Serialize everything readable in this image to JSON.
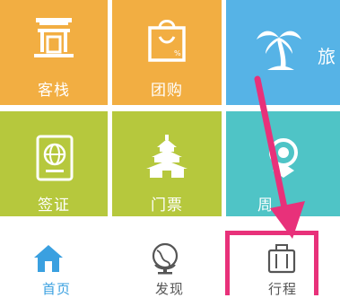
{
  "tiles": [
    {
      "key": "inn",
      "label": "客栈",
      "color": "#f2ae42",
      "icon": "inn-icon"
    },
    {
      "key": "group",
      "label": "团购",
      "color": "#f2ae42",
      "icon": "shopping-bag-icon"
    },
    {
      "key": "travel",
      "label": "旅",
      "color": "#56b3e6",
      "icon": "palm-tree-icon"
    },
    {
      "key": "visa",
      "label": "签证",
      "color": "#b6c83d",
      "icon": "passport-icon"
    },
    {
      "key": "ticket",
      "label": "门票",
      "color": "#b6c83d",
      "icon": "temple-icon"
    },
    {
      "key": "around",
      "label": "周",
      "color": "#4fc4c6",
      "icon": "location-pin-icon"
    }
  ],
  "tabbar": {
    "home": {
      "label": "首页",
      "icon": "home-icon",
      "active": true
    },
    "discover": {
      "label": "发现",
      "icon": "globe-icon",
      "active": false
    },
    "trip": {
      "label": "行程",
      "icon": "luggage-icon",
      "active": false
    }
  },
  "colors": {
    "active_tab": "#3aa0e0",
    "inactive_tab": "#555555",
    "annotation": "#e8317a"
  }
}
